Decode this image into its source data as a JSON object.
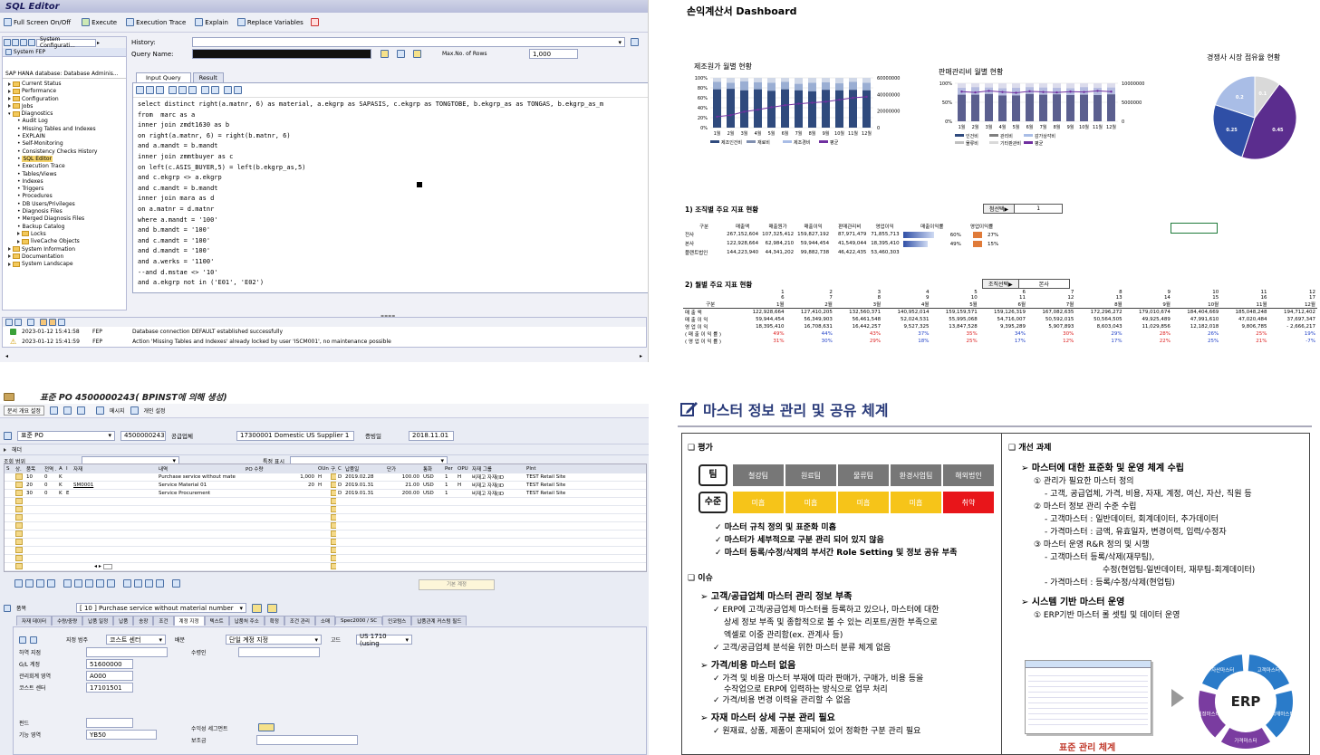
{
  "sql": {
    "title": "SQL Editor",
    "toolbar": [
      "Full Screen On/Off",
      "Execute",
      "Execution Trace",
      "Explain",
      "Replace Variables"
    ],
    "sys_config": "System Configurati...",
    "system": "System FEP",
    "history_label": "History:",
    "query_label": "Query Name:",
    "max_rows_label": "Max.No. of Rows",
    "max_rows": "1,000",
    "db_label": "SAP HANA database: Database Adminis...",
    "tree": [
      {
        "t": "Current Status",
        "k": "folder"
      },
      {
        "t": "Performance",
        "k": "folder"
      },
      {
        "t": "Configuration",
        "k": "folder"
      },
      {
        "t": "Jobs",
        "k": "folder"
      },
      {
        "t": "Diagnostics",
        "k": "open"
      },
      {
        "t": "Audit Log",
        "k": "leaf"
      },
      {
        "t": "Missing Tables and Indexes",
        "k": "leaf"
      },
      {
        "t": "EXPLAIN",
        "k": "leaf"
      },
      {
        "t": "Self-Monitoring",
        "k": "leaf"
      },
      {
        "t": "Consistency Checks History",
        "k": "leaf"
      },
      {
        "t": "SQL Editor",
        "k": "sel"
      },
      {
        "t": "Execution Trace",
        "k": "leaf"
      },
      {
        "t": "Tables/Views",
        "k": "leaf"
      },
      {
        "t": "Indexes",
        "k": "leaf"
      },
      {
        "t": "Triggers",
        "k": "leaf"
      },
      {
        "t": "Procedures",
        "k": "leaf"
      },
      {
        "t": "DB Users/Privileges",
        "k": "leaf"
      },
      {
        "t": "Diagnosis Files",
        "k": "leaf"
      },
      {
        "t": "Merged Diagnosis Files",
        "k": "leaf"
      },
      {
        "t": "Backup Catalog",
        "k": "leaf"
      },
      {
        "t": "Locks",
        "k": "sub"
      },
      {
        "t": "liveCache Objects",
        "k": "sub"
      },
      {
        "t": "System Information",
        "k": "folder"
      },
      {
        "t": "Documentation",
        "k": "folder"
      },
      {
        "t": "System Landscape",
        "k": "folder"
      }
    ],
    "tabs": [
      "Input Query",
      "Result"
    ],
    "code": [
      "select distinct right(a.matnr, 6) as material, a.ekgrp as SAPASIS, c.ekgrp as TONGTOBE, b.ekgrp_as as TONGAS, b.ekgrp_as_m",
      "from  marc as a",
      "inner join zmdt1630 as b",
      "on right(a.matnr, 6) = right(b.matnr, 6)",
      "and a.mandt = b.mandt",
      "inner join zmmtbuyer as c",
      "on left(c.ASIS_BUYER,5) = left(b.ekgrp_as,5)",
      "and c.ekgrp <> a.ekgrp",
      "and c.mandt = b.mandt",
      "inner join mara as d",
      "on a.matnr = d.matnr",
      "where a.mandt = '100'",
      "and b.mandt = '100'",
      "and c.mandt = '100'",
      "and d.mandt = '100'",
      "and a.werks = '1100'",
      "--and d.mstae <> '10'",
      "and a.ekgrp not in ('E01', 'E02')"
    ],
    "log": [
      {
        "time": "2023-01-12 15:41:58",
        "sys": "FEP",
        "msg": "Database connection DEFAULT established successfully",
        "type": "ok"
      },
      {
        "time": "2023-01-12 15:41:59",
        "sys": "FEP",
        "msg": "Action 'Missing Tables and Indexes' already locked by user 'ISCM001', no maintenance possible",
        "type": "warn"
      }
    ]
  },
  "dash": {
    "title": "손익계산서 Dashboard",
    "c1": {
      "title": "제조원가 월별 현황",
      "ylab": [
        "100%",
        "80%",
        "60%",
        "40%",
        "20%",
        "0%"
      ],
      "y2lab": [
        "60000000",
        "40000000",
        "20000000",
        "0"
      ],
      "months": [
        "1월",
        "2월",
        "3월",
        "4월",
        "5월",
        "6월",
        "7월",
        "8월",
        "9월",
        "10월",
        "11월",
        "12월"
      ],
      "legend": [
        "제조인건비",
        "재료비",
        "제조경비",
        "평균"
      ]
    },
    "c2": {
      "title": "판매관리비 월별 현황",
      "ylab": [
        "100%",
        "50%",
        "0%"
      ],
      "y2lab": [
        "10000000",
        "5000000",
        "0"
      ],
      "months": [
        "1월",
        "2월",
        "3월",
        "4월",
        "5월",
        "6월",
        "7월",
        "8월",
        "9월",
        "10월",
        "11월",
        "12월"
      ],
      "legend": [
        "인건비",
        "관리비",
        "감가상각비",
        "물류비",
        "기타판관비",
        "평균"
      ]
    },
    "c3": {
      "title": "경쟁사 시장 점유율 현황",
      "slices": [
        0.45,
        0.25,
        0.2,
        0.1
      ],
      "labels": [
        "0.45",
        "0.25",
        "0.2",
        "0.1"
      ],
      "colors": [
        "#5b2d8e",
        "#2f4fa6",
        "#a9bde6",
        "#d9d9d9"
      ]
    },
    "s1": {
      "title": "1) 조직별 주요 지표 현황",
      "sel": "첨선택▶",
      "sel_val": "1",
      "headers": [
        "구분",
        "매출액",
        "매출원가",
        "매출이익",
        "판매관리비",
        "영업이익",
        "매출이익률",
        "영업이익률"
      ],
      "rows": [
        [
          "전사",
          "267,152,604",
          "107,325,412",
          "159,827,192",
          "87,971,479",
          "71,855,713",
          "60%",
          "27%"
        ],
        [
          "본사",
          "122,928,664",
          "62,984,210",
          "59,944,454",
          "41,549,044",
          "18,395,410",
          "49%",
          "15%"
        ],
        [
          "플랜트법인",
          "144,223,940",
          "44,341,202",
          "99,882,738",
          "46,422,435",
          "53,460,303",
          "",
          ""
        ]
      ],
      "bars": [
        0.6,
        0.49,
        0
      ]
    },
    "s2": {
      "title": "2) 월별 주요 지표 현황",
      "sel": "조직선택▶",
      "sel_val": "본사",
      "nums1": [
        "1",
        "2",
        "3",
        "4",
        "5",
        "6",
        "7",
        "8",
        "9",
        "10",
        "11",
        "12"
      ],
      "nums2": [
        "6",
        "7",
        "8",
        "9",
        "10",
        "11",
        "12",
        "13",
        "14",
        "15",
        "16",
        "17"
      ],
      "headers": [
        "구분",
        "1월",
        "2월",
        "3월",
        "4월",
        "5월",
        "6월",
        "7월",
        "8월",
        "9월",
        "10월",
        "11월",
        "12월"
      ],
      "rows": [
        {
          "l": "매 출 액",
          "v": [
            "122,928,664",
            "127,410,205",
            "132,560,371",
            "140,952,014",
            "159,159,571",
            "159,126,319",
            "167,082,635",
            "172,296,272",
            "179,010,674",
            "184,404,669",
            "185,048,248",
            "194,712,402"
          ],
          "c": ""
        },
        {
          "l": "매 출 이 익",
          "v": [
            "59,944,454",
            "56,349,903",
            "56,461,548",
            "52,024,531",
            "55,995,068",
            "54,716,007",
            "50,592,015",
            "50,564,505",
            "49,925,489",
            "47,991,610",
            "47,020,484",
            "37,697,347"
          ],
          "c": ""
        },
        {
          "l": "영 업 이 익",
          "v": [
            "18,395,410",
            "16,708,631",
            "16,442,257",
            "9,527,325",
            "13,847,528",
            "9,395,289",
            "5,907,893",
            "8,603,043",
            "11,029,856",
            "12,182,018",
            "9,806,785",
            "- 2,666,217"
          ],
          "c": ""
        },
        {
          "l": "( 매 출 이 익 률 )",
          "v": [
            "49%",
            "44%",
            "43%",
            "37%",
            "35%",
            "34%",
            "30%",
            "29%",
            "28%",
            "26%",
            "25%",
            "19%"
          ],
          "c": "pct"
        },
        {
          "l": "( 영 업 이 익 률 )",
          "v": [
            "31%",
            "30%",
            "29%",
            "18%",
            "25%",
            "17%",
            "12%",
            "17%",
            "22%",
            "25%",
            "21%",
            "-7%"
          ],
          "c": "pct"
        }
      ]
    }
  },
  "po": {
    "title": "표준 PO 4500000243( BPINST에 의해 생성)",
    "toolbar": [
      "문서 개요 설정",
      "메시지",
      "개인 설정"
    ],
    "doc_type": "표준 PO",
    "po_no": "4500000243",
    "vendor_label": "공급업체",
    "vendor": "17300001 Domestic US Supplier 1",
    "date_label": "증빙일",
    "date": "2018.11.01",
    "header": "헤더",
    "view_label": "조회 범위",
    "display_label": "특정 표시",
    "cols": [
      "S",
      "상.",
      "품목",
      "전역 ..",
      "A",
      "I",
      "자재",
      "내역",
      "PO 수량",
      "OUn",
      "구.",
      "C",
      "납품일",
      "단가",
      "통화",
      "Per",
      "OPU",
      "자재 그룹",
      "Plnt"
    ],
    "items": [
      {
        "pos": "10",
        "acct": "0",
        "a": "K",
        "i": "",
        "mat": "",
        "desc": "Purchase service without mate",
        "qty": "1,000",
        "un": "H",
        "c": "D",
        "date": "2019.02.28",
        "price": "100.00",
        "cur": "USD",
        "per": "1",
        "opu": "H",
        "grp": "비재고 자재(ID",
        "plnt": "TEST Retail Site"
      },
      {
        "pos": "20",
        "acct": "0",
        "a": "K",
        "i": "",
        "mat": "SM0001",
        "desc": "Service Material 01",
        "qty": "20",
        "un": "H",
        "c": "D",
        "date": "2019.01.31",
        "price": "21.00",
        "cur": "USD",
        "per": "1",
        "opu": "H",
        "grp": "비재고 자재(ID",
        "plnt": "TEST Retail Site"
      },
      {
        "pos": "30",
        "acct": "0",
        "a": "K",
        "i": "E",
        "mat": "",
        "desc": "Service Procurement",
        "qty": "",
        "un": "",
        "c": "D",
        "date": "2019.01.31",
        "price": "200.00",
        "cur": "USD",
        "per": "1",
        "opu": "",
        "grp": "비재고 자재(ID",
        "plnt": "TEST Retail Site"
      }
    ],
    "default_btn": "기본 계정",
    "item_label": "품목",
    "item_sel": "[ 10 ] Purchase service without material number",
    "tabs": [
      "자재 데이터",
      "수량/중량",
      "납품 일정",
      "납품",
      "송장",
      "조건",
      "계정 지정",
      "텍스트",
      "납품처 주소",
      "확정",
      "조건 관리",
      "소매",
      "Spec2000 / SC",
      "인코텀스",
      "납품관계 커스텀 필드"
    ],
    "acct_cat_label": "지정 범주",
    "acct_cat": "코스트 센터",
    "dist_label": "배분",
    "dist": "단일 계정 지정",
    "pr_label": "고드",
    "pr": "US 1710 (using",
    "unload_label": "하역 지점",
    "recip_label": "수령인",
    "gl_label": "G/L 계정",
    "gl": "51600000",
    "ca_label": "관리회계 영역",
    "ca": "A000",
    "cc_label": "코스트 센터",
    "cc": "17101501",
    "rev_label": "수익성 세그먼트",
    "ord_label": "보조금",
    "fund_label": "펀드",
    "fa_label": "기능 영역",
    "fa": "YB50"
  },
  "master": {
    "title": "마스터 정보 관리 및 공유 체계",
    "eval": "평가",
    "team": "팀",
    "level": "수준",
    "teams": [
      "철강팀",
      "원료팀",
      "물류팀",
      "환경사업팀",
      "해외법인"
    ],
    "levels": [
      "미흡",
      "미흡",
      "미흡",
      "미흡",
      "취약"
    ],
    "eval_pts": [
      "마스터 규칙 정의 및 표준화 미흡",
      "마스터가 세부적으로 구분 관리 되어 있지 않음",
      "마스터 등록/수정/삭제의 부서간 Role Setting 및 정보 공유 부족"
    ],
    "issue": "이슈",
    "i1": "고객/공급업체 마스터 관리 정보 부족",
    "i1a": "ERP에 고객/공급업체 마스터를 등록하고 있으나, 마스터에 대한",
    "i1b": "상세 정보 부족 및 종합적으로 볼 수 있는 리포트/권한 부족으로",
    "i1c": "엑셀로 이중 관리함(ex. 관계사 등)",
    "i1d": "고객/공급업체 분석을 위한 마스터 분류 체계 없음",
    "i2": "가격/비용 마스터 없음",
    "i2a": "가격 및 비용 마스터 부재에 따라 판매가, 구매가, 비용 등을",
    "i2b": "수작업으로 ERP에 입력하는 방식으로 업무 처리",
    "i2c": "가격/비용 변경 이력을 관리할 수 없음",
    "i3": "자재 마스터 상세 구분 관리 필요",
    "i3a": "원재료, 상품, 제품이 혼재되어 있어 정확한 구분 관리 필요",
    "imp": "개선 과제",
    "p1": "마스터에 대한 표준화 및 운영 체계 수립",
    "p1a": "① 관리가 필요한 마스터 정의",
    "p1b": "- 고객, 공급업체, 가격, 비용, 자재, 계정, 여신, 자산, 직원 등",
    "p1c": "② 마스터 정보 관리 수준 수립",
    "p1d": "- 고객마스터 : 일반데이터, 회계데이터, 추가데이터",
    "p1e": "- 가격마스터 : 금액, 유효일자, 변경이력, 입력/수정자",
    "p1f": "③ 마스터 운영 R&R 정의 및 시행",
    "p1g": "- 고객마스터 등록/삭제(재무팀),",
    "p1h": "수정(현업팀-일반데이터, 재무팀-회계데이터)",
    "p1i": "- 가격마스터 : 등록/수정/삭제(현업팀)",
    "p2": "시스템 기반 마스터 운영",
    "p2a": "① ERP기반 마스터 롤 셋팅 및 데이터 운영",
    "std": "표준 관리 체계",
    "erp": "ERP",
    "cyc": [
      "고객마스터",
      "자재마스터",
      "가격마스터",
      "계정마스터",
      "자산마스터"
    ]
  }
}
